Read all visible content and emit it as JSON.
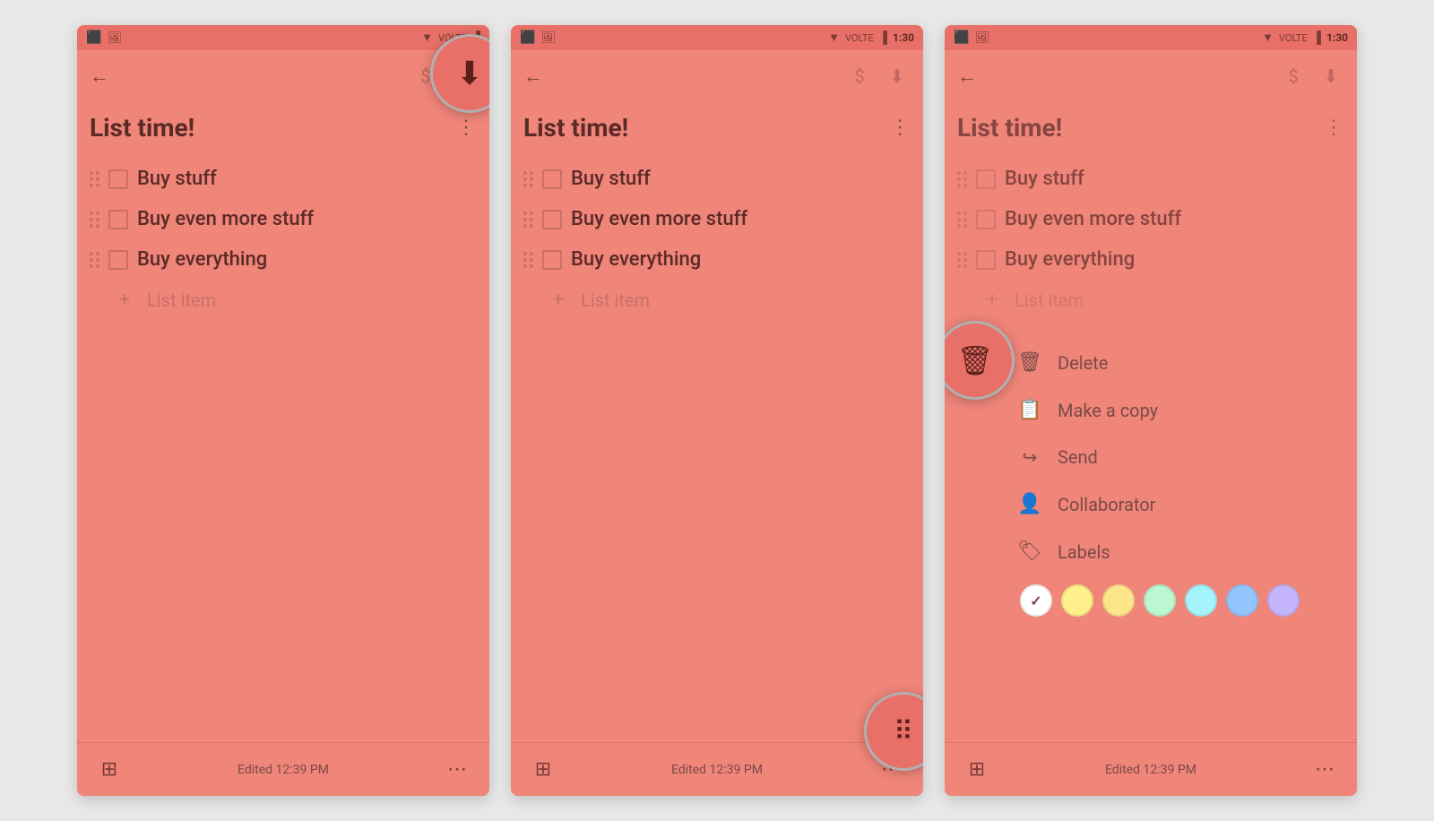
{
  "colors": {
    "bg": "#f0857a",
    "statusBg": "#e87068",
    "text": "#5a2a27",
    "muted": "#c97068",
    "mutedDark": "#7a4a45"
  },
  "phones": [
    {
      "id": "phone-1",
      "showFabTop": true,
      "showFabBottom": false,
      "showContextMenu": false,
      "statusTime": "",
      "title": "List time!",
      "items": [
        "Buy stuff",
        "Buy even more stuff",
        "Buy everything"
      ],
      "addLabel": "List item",
      "editedText": "Edited 12:39 PM"
    },
    {
      "id": "phone-2",
      "showFabTop": false,
      "showFabBottom": true,
      "showContextMenu": false,
      "statusTime": "1:30",
      "title": "List time!",
      "items": [
        "Buy stuff",
        "Buy even more stuff",
        "Buy everything"
      ],
      "addLabel": "List item",
      "editedText": "Edited 12:39 PM"
    },
    {
      "id": "phone-3",
      "showFabTop": false,
      "showFabBottom": false,
      "showFabTrash": true,
      "showContextMenu": true,
      "statusTime": "1:30",
      "title": "List time!",
      "items": [
        "Buy stuff",
        "Buy even more stuff",
        "Buy everything"
      ],
      "addLabel": "List item",
      "editedText": "Edited 12:39 PM",
      "contextMenu": {
        "items": [
          {
            "icon": "🗑",
            "label": "Delete"
          },
          {
            "icon": "📋",
            "label": "Make a copy"
          },
          {
            "icon": "↪",
            "label": "Send"
          },
          {
            "icon": "👤",
            "label": "Collaborator"
          },
          {
            "icon": "🏷",
            "label": "Labels"
          }
        ],
        "swatches": [
          {
            "color": "#ffffff",
            "selected": true
          },
          {
            "color": "#fef08a"
          },
          {
            "color": "#fde68a"
          },
          {
            "color": "#bbf7d0"
          },
          {
            "color": "#a5f3fc"
          },
          {
            "color": "#93c5fd"
          },
          {
            "color": "#c4b5fd"
          }
        ]
      }
    }
  ],
  "labels": {
    "title": "List time!",
    "item1": "Buy stuff",
    "item2": "Buy even more stuff",
    "item3": "Buy everything",
    "addItem": "List item",
    "edited": "Edited 12:39 PM",
    "delete": "Delete",
    "makeCopy": "Make a copy",
    "send": "Send",
    "collaborator": "Collaborator",
    "labelsMenu": "Labels"
  }
}
